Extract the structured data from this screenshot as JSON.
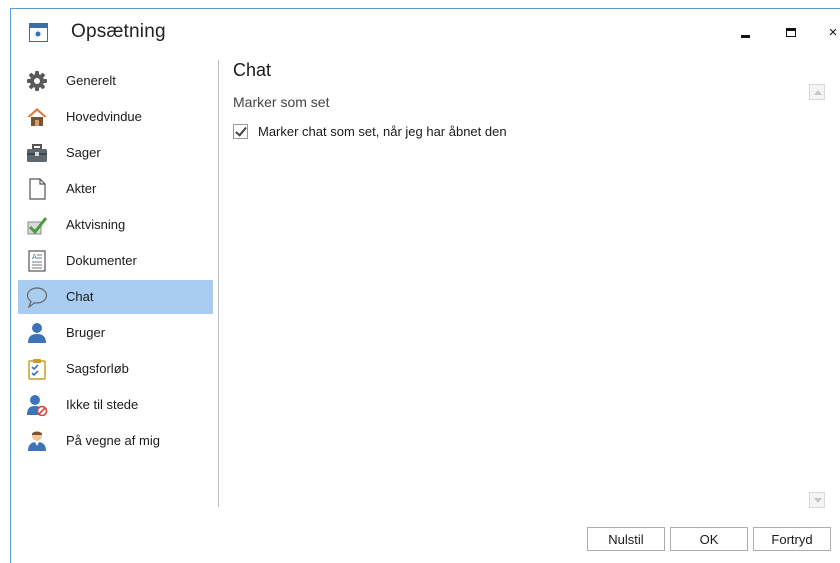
{
  "window": {
    "title": "Opsætning",
    "close_glyph": "×"
  },
  "sidebar": {
    "items": [
      {
        "label": "Generelt",
        "icon": "gear-icon"
      },
      {
        "label": "Hovedvindue",
        "icon": "home-icon"
      },
      {
        "label": "Sager",
        "icon": "briefcase-icon"
      },
      {
        "label": "Akter",
        "icon": "document-icon"
      },
      {
        "label": "Aktvisning",
        "icon": "checkmark-icon"
      },
      {
        "label": "Dokumenter",
        "icon": "text-document-icon"
      },
      {
        "label": "Chat",
        "icon": "speech-bubble-icon"
      },
      {
        "label": "Bruger",
        "icon": "user-icon"
      },
      {
        "label": "Sagsforløb",
        "icon": "clipboard-icon"
      },
      {
        "label": "Ikke til stede",
        "icon": "user-away-icon"
      },
      {
        "label": "På vegne af mig",
        "icon": "delegate-user-icon"
      }
    ],
    "active_index": 6
  },
  "content": {
    "heading": "Chat",
    "section_title": "Marker som set",
    "checkbox_label": "Marker chat som set, når jeg har åbnet den",
    "checkbox_checked": true
  },
  "footer": {
    "reset_label": "Nulstil",
    "ok_label": "OK",
    "cancel_label": "Fortryd"
  },
  "colors": {
    "active_item": "#a9cdf0",
    "window_border": "#5b9bd5"
  }
}
